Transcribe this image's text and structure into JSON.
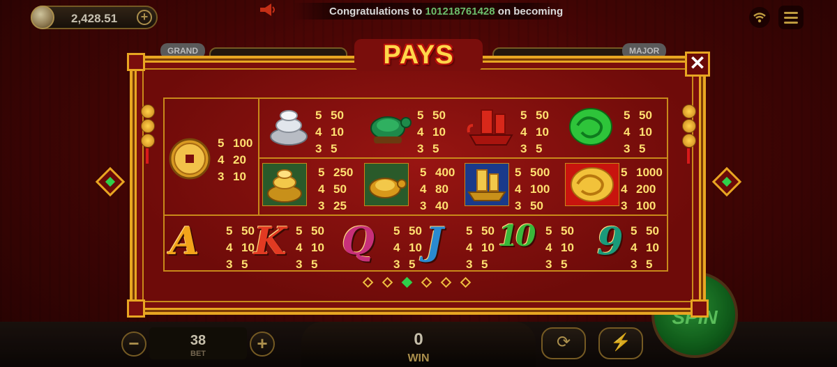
{
  "balance": "2,428.51",
  "ticker": {
    "prefix": "Congratulations to",
    "user": "101218761428",
    "suffix": "on becoming"
  },
  "jackpots": {
    "grand_label": "GRAND",
    "major_label": "MAJOR"
  },
  "paytable": {
    "title": "PAYS",
    "close_label": "✕",
    "wild": {
      "symbol": "coin-icon",
      "pays": [
        {
          "n": "5",
          "v": "100"
        },
        {
          "n": "4",
          "v": "20"
        },
        {
          "n": "3",
          "v": "10"
        }
      ]
    },
    "row1": [
      {
        "symbol": "silver-ingot-icon",
        "pays": [
          {
            "n": "5",
            "v": "50"
          },
          {
            "n": "4",
            "v": "10"
          },
          {
            "n": "3",
            "v": "5"
          }
        ]
      },
      {
        "symbol": "green-turtle-icon",
        "pays": [
          {
            "n": "5",
            "v": "50"
          },
          {
            "n": "4",
            "v": "10"
          },
          {
            "n": "3",
            "v": "5"
          }
        ]
      },
      {
        "symbol": "red-ship-icon",
        "pays": [
          {
            "n": "5",
            "v": "50"
          },
          {
            "n": "4",
            "v": "10"
          },
          {
            "n": "3",
            "v": "5"
          }
        ]
      },
      {
        "symbol": "jade-dragon-icon",
        "pays": [
          {
            "n": "5",
            "v": "50"
          },
          {
            "n": "4",
            "v": "10"
          },
          {
            "n": "3",
            "v": "5"
          }
        ]
      }
    ],
    "row2": [
      {
        "symbol": "gold-ingot-icon",
        "pays": [
          {
            "n": "5",
            "v": "250"
          },
          {
            "n": "4",
            "v": "50"
          },
          {
            "n": "3",
            "v": "25"
          }
        ]
      },
      {
        "symbol": "gold-turtle-icon",
        "pays": [
          {
            "n": "5",
            "v": "400"
          },
          {
            "n": "4",
            "v": "80"
          },
          {
            "n": "3",
            "v": "40"
          }
        ]
      },
      {
        "symbol": "gold-ship-icon",
        "pays": [
          {
            "n": "5",
            "v": "500"
          },
          {
            "n": "4",
            "v": "100"
          },
          {
            "n": "3",
            "v": "50"
          }
        ]
      },
      {
        "symbol": "gold-dragon-icon",
        "pays": [
          {
            "n": "5",
            "v": "1000"
          },
          {
            "n": "4",
            "v": "200"
          },
          {
            "n": "3",
            "v": "100"
          }
        ]
      }
    ],
    "row3": [
      {
        "symbol": "letter-a-icon",
        "glyph": "A",
        "color": "#f2a41a",
        "pays": [
          {
            "n": "5",
            "v": "50"
          },
          {
            "n": "4",
            "v": "10"
          },
          {
            "n": "3",
            "v": "5"
          }
        ]
      },
      {
        "symbol": "letter-k-icon",
        "glyph": "K",
        "color": "#e23a22",
        "pays": [
          {
            "n": "5",
            "v": "50"
          },
          {
            "n": "4",
            "v": "10"
          },
          {
            "n": "3",
            "v": "5"
          }
        ]
      },
      {
        "symbol": "letter-q-icon",
        "glyph": "Q",
        "color": "#c8307a",
        "pays": [
          {
            "n": "5",
            "v": "50"
          },
          {
            "n": "4",
            "v": "10"
          },
          {
            "n": "3",
            "v": "5"
          }
        ]
      },
      {
        "symbol": "letter-j-icon",
        "glyph": "J",
        "color": "#2a8ad0",
        "pays": [
          {
            "n": "5",
            "v": "50"
          },
          {
            "n": "4",
            "v": "10"
          },
          {
            "n": "3",
            "v": "5"
          }
        ]
      },
      {
        "symbol": "number-10-icon",
        "glyph": "10",
        "color": "#3ab83a",
        "pays": [
          {
            "n": "5",
            "v": "50"
          },
          {
            "n": "4",
            "v": "10"
          },
          {
            "n": "3",
            "v": "5"
          }
        ]
      },
      {
        "symbol": "number-9-icon",
        "glyph": "9",
        "color": "#1a9a7a",
        "pays": [
          {
            "n": "5",
            "v": "50"
          },
          {
            "n": "4",
            "v": "10"
          },
          {
            "n": "3",
            "v": "5"
          }
        ]
      }
    ],
    "page_count": 6,
    "active_page": 3
  },
  "bottom": {
    "bet_value": "38",
    "bet_label": "BET",
    "win_value": "0",
    "win_label": "WIN",
    "spin_label": "SPIN"
  },
  "colors": {
    "accent_gold": "#e8a622",
    "pay_text": "#ffe070",
    "active_dot": "#2fd04a"
  }
}
